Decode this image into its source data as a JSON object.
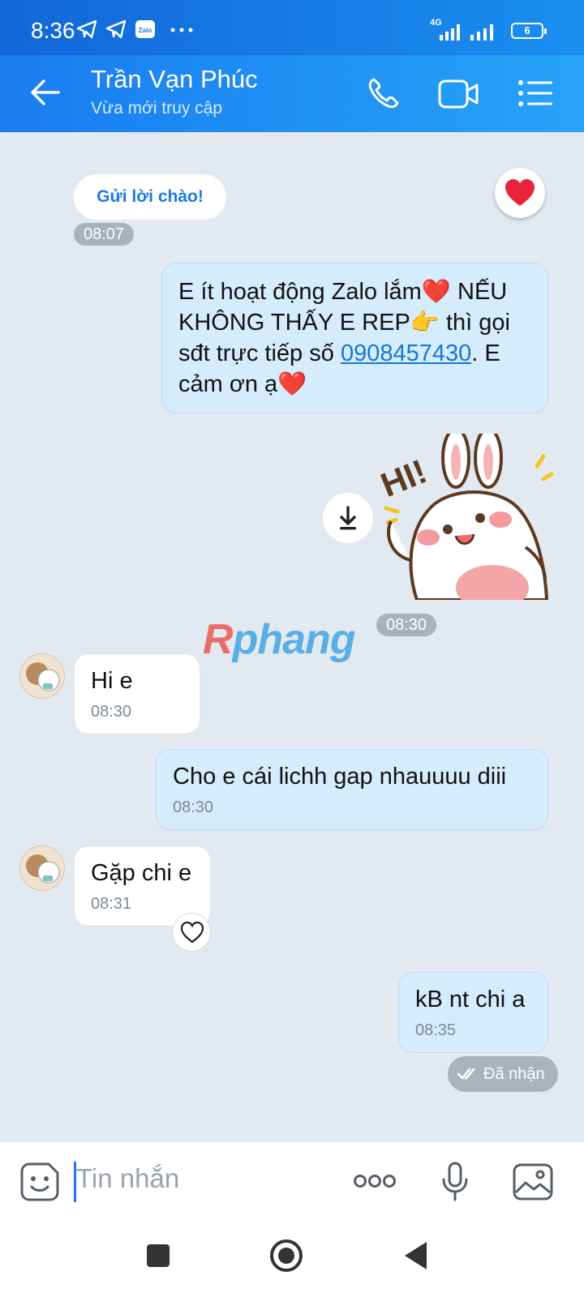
{
  "status_bar": {
    "time": "8:36",
    "network": "4G",
    "battery": "6"
  },
  "header": {
    "contact_name": "Trần Vạn Phúc",
    "contact_status": "Vừa mới truy cập"
  },
  "chat": {
    "greeting_button": "Gửi lời chào!",
    "greeting_time": "08:07",
    "pinned_message": {
      "text_part1": "E ít hoạt động Zalo lắm❤️ NẾU KHÔNG THẤY E REP👉 thì gọi sđt trực tiếp số ",
      "phone_link": "0908457430",
      "text_part2": ". E cảm ơn ạ❤️"
    },
    "sticker_time": "08:30",
    "sticker_text": "HI!",
    "watermark": {
      "part1": "R",
      "part2": "phang"
    },
    "messages": [
      {
        "side": "in",
        "text": "Hi e",
        "time": "08:30"
      },
      {
        "side": "out",
        "text": "Cho e cái lichh gap nhauuuu diii",
        "time": "08:30"
      },
      {
        "side": "in",
        "text": "Gặp chi e",
        "time": "08:31"
      },
      {
        "side": "out",
        "text": "kB nt chi a",
        "time": "08:35"
      }
    ],
    "delivery_status": "Đã nhận"
  },
  "input": {
    "placeholder": "Tin nhắn"
  },
  "icons": {
    "back": "arrow-left-icon",
    "call": "phone-icon",
    "video": "video-camera-icon",
    "menu": "list-menu-icon",
    "emoji": "sticker-face-icon",
    "more": "more-dots-icon",
    "mic": "microphone-icon",
    "gallery": "image-icon",
    "download": "download-icon",
    "reaction": "heart-outline-icon"
  },
  "colors": {
    "header": "#1a7cf0",
    "chat_bg": "#e2e9f1",
    "outgoing_bubble": "#d5ecfd",
    "accent": "#1a7ce0"
  }
}
